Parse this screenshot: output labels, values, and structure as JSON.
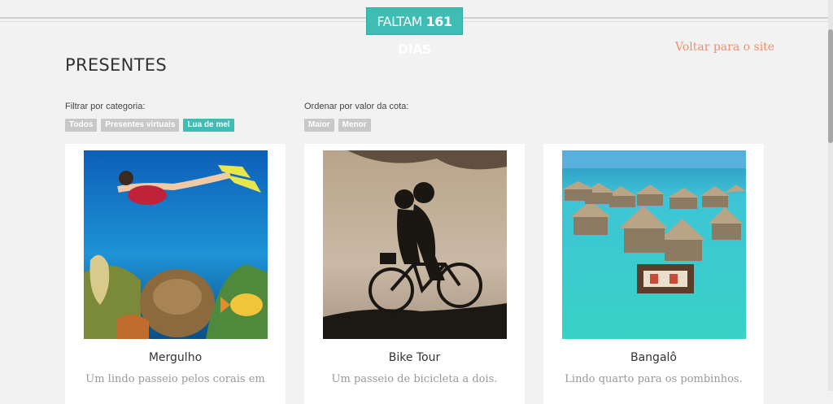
{
  "header": {
    "countdown_prefix": "FALTAM",
    "countdown_number": "161",
    "countdown_suffix": "DIAS",
    "back_link": "Voltar para o site"
  },
  "page": {
    "title": "PRESENTES"
  },
  "filter": {
    "label": "Filtrar por categoria:",
    "options": [
      "Todos",
      "Presentes virtuais",
      "Lua de mel"
    ],
    "active": "Lua de mel"
  },
  "sort": {
    "label": "Ordenar por valor da cota:",
    "options": [
      "Maior",
      "Menor"
    ]
  },
  "gifts": [
    {
      "name": "Mergulho",
      "description": "Um lindo passeio pelos corais em",
      "image": "diver-underwater-photo"
    },
    {
      "name": "Bike Tour",
      "description": "Um passeio de bicicleta a dois.",
      "image": "couple-bicycle-silhouette-photo"
    },
    {
      "name": "Bangalô",
      "description": "Lindo quarto para os pombinhos.",
      "image": "overwater-bungalows-photo"
    }
  ],
  "colors": {
    "accent": "#3dbdb3",
    "link": "#ef8f6e",
    "background": "#f2f2f2"
  }
}
